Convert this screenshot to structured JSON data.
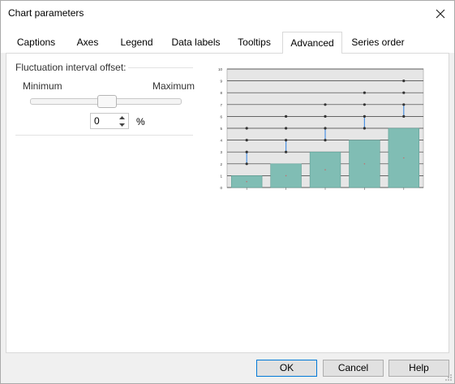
{
  "window": {
    "title": "Chart parameters"
  },
  "tabs": [
    {
      "label": "Captions",
      "active": false
    },
    {
      "label": "Axes",
      "active": false
    },
    {
      "label": "Legend",
      "active": false
    },
    {
      "label": "Data labels",
      "active": false
    },
    {
      "label": "Tooltips",
      "active": false
    },
    {
      "label": "Advanced",
      "active": true
    },
    {
      "label": "Series order",
      "active": false
    }
  ],
  "advanced": {
    "group_label": "Fluctuation interval offset:",
    "min_label": "Minimum",
    "max_label": "Maximum",
    "slider_value": 0.5,
    "offset_value": "0",
    "unit": "%"
  },
  "preview_chart": {
    "y_ticks": [
      "0",
      "1",
      "2",
      "3",
      "4",
      "5",
      "6",
      "7",
      "8",
      "9",
      "10"
    ],
    "bar_fill": "#80bdb4",
    "plot_bg": "#e6e6e6",
    "whisker_color": "#4a90e2",
    "bars": [
      1,
      2,
      3,
      4,
      5
    ],
    "whiskers": [
      {
        "markers": [
          2,
          3,
          4,
          5
        ],
        "range": [
          2,
          3
        ]
      },
      {
        "markers": [
          3,
          4,
          5,
          6
        ],
        "range": [
          3,
          4
        ]
      },
      {
        "markers": [
          4,
          5,
          6,
          7
        ],
        "range": [
          4,
          5
        ]
      },
      {
        "markers": [
          5,
          6,
          7,
          8
        ],
        "range": [
          5,
          6
        ]
      },
      {
        "markers": [
          6,
          7,
          8,
          9
        ],
        "range": [
          6,
          7
        ]
      }
    ]
  },
  "buttons": {
    "ok": "OK",
    "cancel": "Cancel",
    "help": "Help"
  }
}
